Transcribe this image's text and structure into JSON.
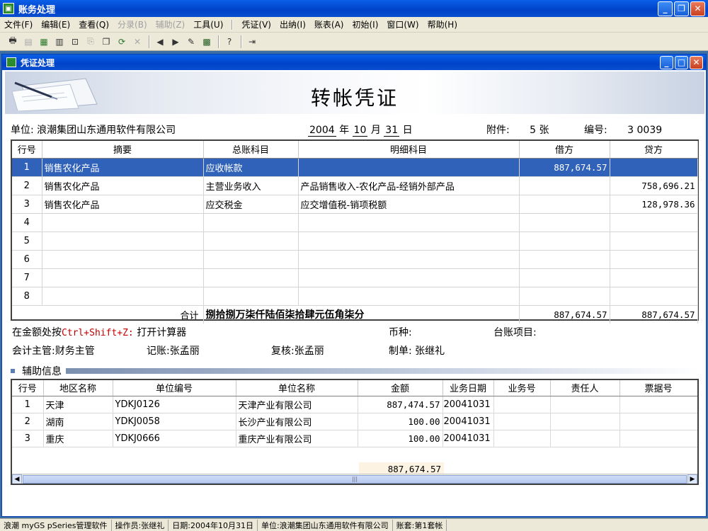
{
  "window": {
    "title": "账务处理"
  },
  "menu": {
    "items": [
      {
        "label": "文件(F)",
        "disabled": false
      },
      {
        "label": "编辑(E)",
        "disabled": false
      },
      {
        "label": "查看(Q)",
        "disabled": false
      },
      {
        "label": "分录(B)",
        "disabled": true
      },
      {
        "label": "辅助(Z)",
        "disabled": true
      },
      {
        "label": "工具(U)",
        "disabled": false
      }
    ],
    "items2": [
      {
        "label": "凭证(V)"
      },
      {
        "label": "出纳(I)"
      },
      {
        "label": "账表(A)"
      },
      {
        "label": "初始(I)"
      },
      {
        "label": "窗口(W)"
      },
      {
        "label": "帮助(H)"
      }
    ]
  },
  "inner_window": {
    "title": "凭证处理"
  },
  "voucher": {
    "title": "转帐凭证",
    "unit_label": "单位:",
    "unit": "浪潮集团山东通用软件有限公司",
    "year": "2004",
    "year_label": "年",
    "month": "10",
    "month_label": "月",
    "day": "31",
    "day_label": "日",
    "attach_label": "附件:",
    "attach": "5 张",
    "number_label": "编号:",
    "number": "3 0039"
  },
  "grid": {
    "headers": [
      "行号",
      "摘要",
      "总账科目",
      "明细科目",
      "借方",
      "贷方"
    ],
    "rows": [
      {
        "no": "1",
        "summary": "销售农化产品",
        "account": "应收帐款",
        "detail": "",
        "debit": "887,674.57",
        "credit": ""
      },
      {
        "no": "2",
        "summary": "销售农化产品",
        "account": "主营业务收入",
        "detail": "产品销售收入-农化产品-经销外部产品",
        "debit": "",
        "credit": "758,696.21"
      },
      {
        "no": "3",
        "summary": "销售农化产品",
        "account": "应交税金",
        "detail": "应交增值税-销项税额",
        "debit": "",
        "credit": "128,978.36"
      },
      {
        "no": "4",
        "summary": "",
        "account": "",
        "detail": "",
        "debit": "",
        "credit": ""
      },
      {
        "no": "5",
        "summary": "",
        "account": "",
        "detail": "",
        "debit": "",
        "credit": ""
      },
      {
        "no": "6",
        "summary": "",
        "account": "",
        "detail": "",
        "debit": "",
        "credit": ""
      },
      {
        "no": "7",
        "summary": "",
        "account": "",
        "detail": "",
        "debit": "",
        "credit": ""
      },
      {
        "no": "8",
        "summary": "",
        "account": "",
        "detail": "",
        "debit": "",
        "credit": ""
      }
    ],
    "total_label": "合计",
    "total_words": "捌拾捌万柒仟陆佰柒拾肆元伍角柒分",
    "total_debit": "887,674.57",
    "total_credit": "887,674.57"
  },
  "footer": {
    "calc_hint_prefix": "在金额处按",
    "calc_shortcut": "Ctrl+Shift+Z:",
    "calc_hint_suffix": "打开计算器",
    "currency_label": "币种:",
    "ledger_label": "台账项目:",
    "supervisor": "会计主管:财务主管",
    "bookkeeper": "记账:张孟丽",
    "reviewer": "复核:张孟丽",
    "preparer": "制单: 张继礼"
  },
  "aux": {
    "label": "辅助信息",
    "headers": [
      "行号",
      "地区名称",
      "单位编号",
      "单位名称",
      "金额",
      "业务日期",
      "业务号",
      "责任人",
      "票据号"
    ],
    "rows": [
      {
        "no": "1",
        "region": "天津",
        "code": "YDKJ0126",
        "name": "天津产业有限公司",
        "amount": "887,474.57",
        "date": "20041031"
      },
      {
        "no": "2",
        "region": "湖南",
        "code": "YDKJ0058",
        "name": "长沙产业有限公司",
        "amount": "100.00",
        "date": "20041031"
      },
      {
        "no": "3",
        "region": "重庆",
        "code": "YDKJ0666",
        "name": "重庆产业有限公司",
        "amount": "100.00",
        "date": "20041031"
      }
    ],
    "total": "887,674.57"
  },
  "status": {
    "app": "浪潮 myGS pSeries管理软件",
    "operator": "操作员:张继礼",
    "date": "日期:2004年10月31日",
    "unit": "单位:浪潮集团山东通用软件有限公司",
    "book": "账套:第1套帐"
  }
}
